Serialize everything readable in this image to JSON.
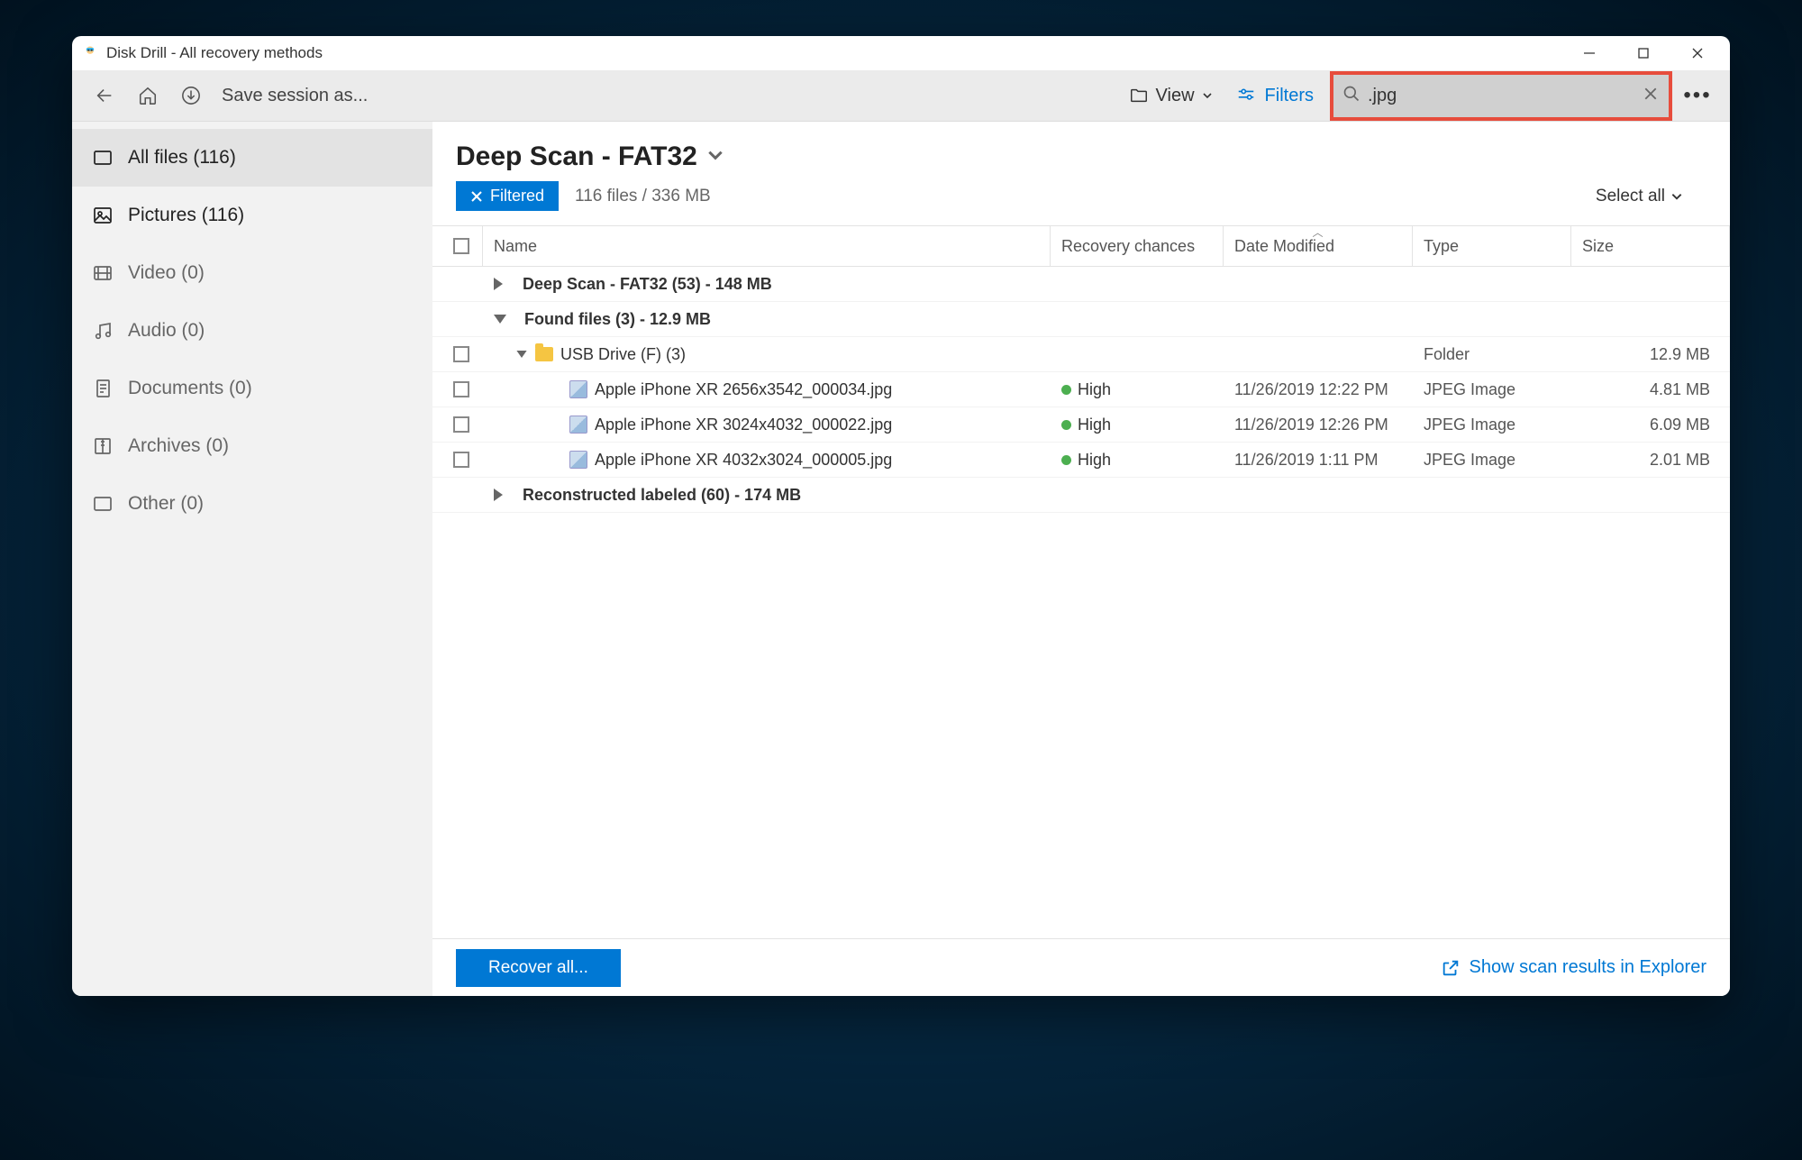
{
  "title": "Disk Drill - All recovery methods",
  "toolbar": {
    "save": "Save session as...",
    "view": "View",
    "filters": "Filters",
    "search": ".jpg"
  },
  "sidebar": [
    {
      "label": "All files (116)",
      "icon": "all"
    },
    {
      "label": "Pictures (116)",
      "icon": "pic",
      "sel": true
    },
    {
      "label": "Video (0)",
      "icon": "vid"
    },
    {
      "label": "Audio (0)",
      "icon": "aud"
    },
    {
      "label": "Documents (0)",
      "icon": "doc"
    },
    {
      "label": "Archives (0)",
      "icon": "arc"
    },
    {
      "label": "Other (0)",
      "icon": "oth"
    }
  ],
  "heading": "Deep Scan - FAT32",
  "filteredBadge": "Filtered",
  "fileCount": "116 files / 336 MB",
  "selectAll": "Select all",
  "cols": {
    "name": "Name",
    "rec": "Recovery chances",
    "date": "Date Modified",
    "type": "Type",
    "size": "Size"
  },
  "groups": {
    "g0": "Deep Scan - FAT32 (53) - 148 MB",
    "g1": "Found files (3) - 12.9 MB",
    "g2": "Reconstructed labeled (60) - 174 MB",
    "folder": {
      "name": "USB Drive (F) (3)",
      "type": "Folder",
      "size": "12.9 MB"
    }
  },
  "files": [
    {
      "name": "Apple iPhone XR 2656x3542_000034.jpg",
      "rec": "High",
      "date": "11/26/2019 12:22 PM",
      "type": "JPEG Image",
      "size": "4.81 MB"
    },
    {
      "name": "Apple iPhone XR 3024x4032_000022.jpg",
      "rec": "High",
      "date": "11/26/2019 12:26 PM",
      "type": "JPEG Image",
      "size": "6.09 MB"
    },
    {
      "name": "Apple iPhone XR 4032x3024_000005.jpg",
      "rec": "High",
      "date": "11/26/2019 1:11 PM",
      "type": "JPEG Image",
      "size": "2.01 MB"
    }
  ],
  "footer": {
    "recover": "Recover all...",
    "explorer": "Show scan results in Explorer"
  }
}
